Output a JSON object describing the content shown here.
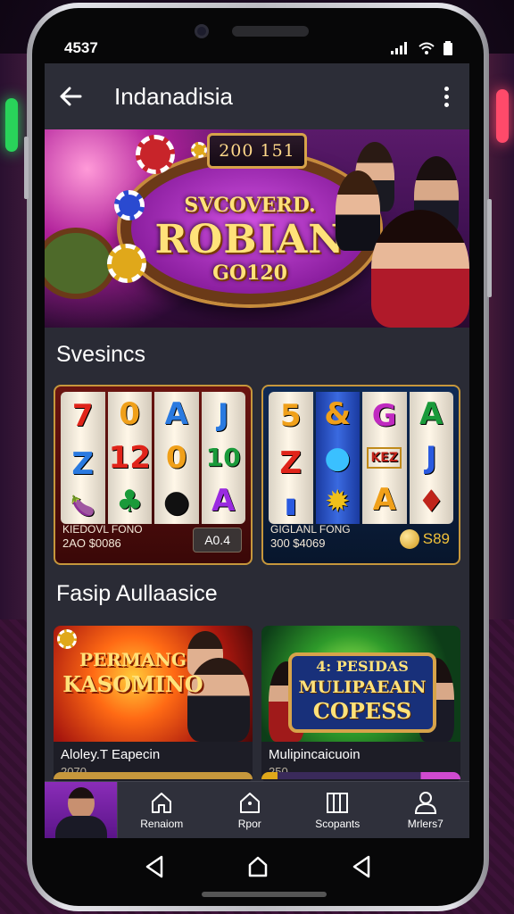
{
  "status_bar": {
    "time": "4537"
  },
  "app_bar": {
    "title": "Indanadisia"
  },
  "hero": {
    "plaque": "200 151",
    "line1": "SVCOVERD.",
    "line2": "ROBIAN",
    "line3": "GO120"
  },
  "section1": {
    "title": "Svesincs",
    "cards": [
      {
        "reels": [
          [
            "7",
            "Z",
            "🍆"
          ],
          [
            "0",
            "12",
            "♣"
          ],
          [
            "A",
            "0",
            "●"
          ],
          [
            "J",
            "10",
            "A"
          ]
        ],
        "line1": "KIEDOVL FONO",
        "line2": "2AO $0086",
        "badge": "A0.4"
      },
      {
        "reels": [
          [
            "5",
            "Z",
            "▮"
          ],
          [
            "&",
            "●",
            "✹"
          ],
          [
            "G",
            "KEZ",
            "A"
          ],
          [
            "A",
            "J",
            "♦"
          ]
        ],
        "line1": "GIGLANL FONG",
        "line2": "300 $4069",
        "badge": "S89"
      }
    ]
  },
  "section2": {
    "title": "Fasip Aullaasice",
    "cards": [
      {
        "art_line1": "PERMANG",
        "art_line2": "KASOMINO",
        "title": "Aloley.T Eapecin",
        "sub": "2070"
      },
      {
        "art_line1": "4: PESIDAS",
        "art_line2": "MULIPAEAIN",
        "art_line3": "COPESS",
        "title": "Mulipincaicuoin",
        "sub": "250"
      }
    ]
  },
  "bottom_nav": {
    "items": [
      {
        "label": "Renaiom",
        "icon": "home-icon"
      },
      {
        "label": "Rpor",
        "icon": "house-outline-icon"
      },
      {
        "label": "Scopants",
        "icon": "columns-icon"
      },
      {
        "label": "Mrlers7",
        "icon": "person-icon"
      }
    ]
  },
  "colors": {
    "screen_bg": "#2a2b35",
    "accent_gold": "#ffd98a",
    "nav_bg": "#2f303b"
  }
}
